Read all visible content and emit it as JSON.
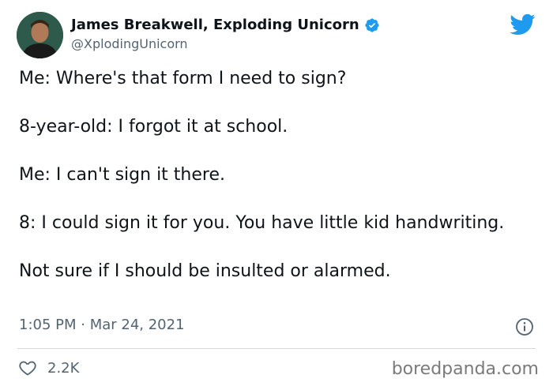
{
  "author": {
    "display_name": "James Breakwell, Exploding Unicorn",
    "handle": "@XplodingUnicorn",
    "verified": true
  },
  "tweet": {
    "paragraphs": [
      "Me: Where's that form I need to sign?",
      "8-year-old: I forgot it at school.",
      "Me: I can't sign it there.",
      "8: I could sign it for you. You have little kid handwriting.",
      "Not sure if I should be insulted or alarmed."
    ],
    "timestamp": "1:05 PM · Mar 24, 2021",
    "likes": "2.2K"
  },
  "watermark": "boredpanda.com",
  "icons": {
    "brand": "twitter-bird-icon",
    "verified": "verified-badge-icon",
    "info": "info-icon",
    "like": "heart-icon"
  },
  "colors": {
    "twitter_blue": "#1d9bf0",
    "secondary_text": "#536471",
    "primary_text": "#0f1419"
  }
}
